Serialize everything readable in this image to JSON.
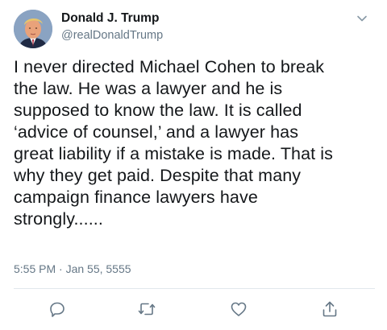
{
  "author": {
    "display_name": "Donald J. Trump",
    "handle": "@realDonaldTrump",
    "avatar_icon": "profile-photo"
  },
  "tweet": {
    "lines": [
      "I never directed Michael Cohen to break",
      "the law. He was a lawyer and he is",
      "supposed to know the law. It is called",
      "‘advice of counsel,’ and a lawyer has",
      "great liability if a mistake is made. That is",
      "why they get paid. Despite that many",
      "campaign finance lawyers have",
      "strongly......"
    ],
    "timestamp": "5:55 PM · Jan 55, 5555"
  },
  "actions": {
    "reply_icon": "reply-icon",
    "retweet_icon": "retweet-icon",
    "like_icon": "heart-icon",
    "share_icon": "share-icon"
  },
  "colors": {
    "text": "#14171a",
    "secondary": "#657786",
    "divider": "#e1e8ed"
  }
}
